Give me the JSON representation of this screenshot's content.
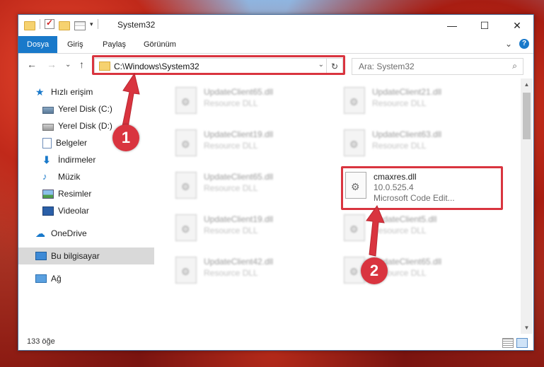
{
  "window": {
    "title": "System32",
    "controls": {
      "minimize": "—",
      "maximize": "☐",
      "close": "✕"
    }
  },
  "ribbon": {
    "tabs": [
      "Dosya",
      "Giriş",
      "Paylaş",
      "Görünüm"
    ],
    "expand_glyph": "⌄",
    "help_glyph": "?"
  },
  "address": {
    "path": "C:\\Windows\\System32",
    "search_placeholder": "Ara: System32"
  },
  "nav": {
    "back": "←",
    "forward": "→",
    "recent": "⌄",
    "up": "↑"
  },
  "sidebar": {
    "items": [
      {
        "label": "Hızlı erişim",
        "icon": "star-icon",
        "pinned": false
      },
      {
        "label": "Yerel Disk (C:)",
        "icon": "disk-icon",
        "pinned": true
      },
      {
        "label": "Yerel Disk (D:)",
        "icon": "disk-icon",
        "pinned": true
      },
      {
        "label": "Belgeler",
        "icon": "documents-icon",
        "pinned": true
      },
      {
        "label": "İndirmeler",
        "icon": "download-icon",
        "pinned": true
      },
      {
        "label": "Müzik",
        "icon": "music-icon",
        "pinned": true
      },
      {
        "label": "Resimler",
        "icon": "pictures-icon",
        "pinned": true
      },
      {
        "label": "Videolar",
        "icon": "videos-icon",
        "pinned": true
      },
      {
        "label": "OneDrive",
        "icon": "cloud-icon",
        "pinned": false
      },
      {
        "label": "Bu bilgisayar",
        "icon": "computer-icon",
        "pinned": false
      },
      {
        "label": "Ağ",
        "icon": "network-icon",
        "pinned": false
      }
    ],
    "pin_glyph": "📌"
  },
  "files": [
    {
      "name": "UpdateClient65.dll",
      "desc": "Resource DLL"
    },
    {
      "name": "UpdateClient21.dll",
      "desc": "Resource DLL"
    },
    {
      "name": "UpdateClient19.dll",
      "desc": "Resource DLL"
    },
    {
      "name": "UpdateClient63.dll",
      "desc": "Resource DLL"
    },
    {
      "name": "UpdateClient65.dll",
      "desc": "Resource DLL"
    },
    {
      "name": "cmaxres.dll",
      "version": "10.0.525.4",
      "desc": "Microsoft Code Edit..."
    },
    {
      "name": "UpdateClient19.dll",
      "desc": "Resource DLL"
    },
    {
      "name": "UpdateClient5.dll",
      "desc": "Resource DLL"
    },
    {
      "name": "UpdateClient42.dll",
      "desc": "Resource DLL"
    },
    {
      "name": "UpdateClient65.dll",
      "desc": "Resource DLL"
    }
  ],
  "status": {
    "count": "133 öğe"
  },
  "annotations": {
    "badge1": "1",
    "badge2": "2",
    "highlight_color": "#d9343f"
  }
}
